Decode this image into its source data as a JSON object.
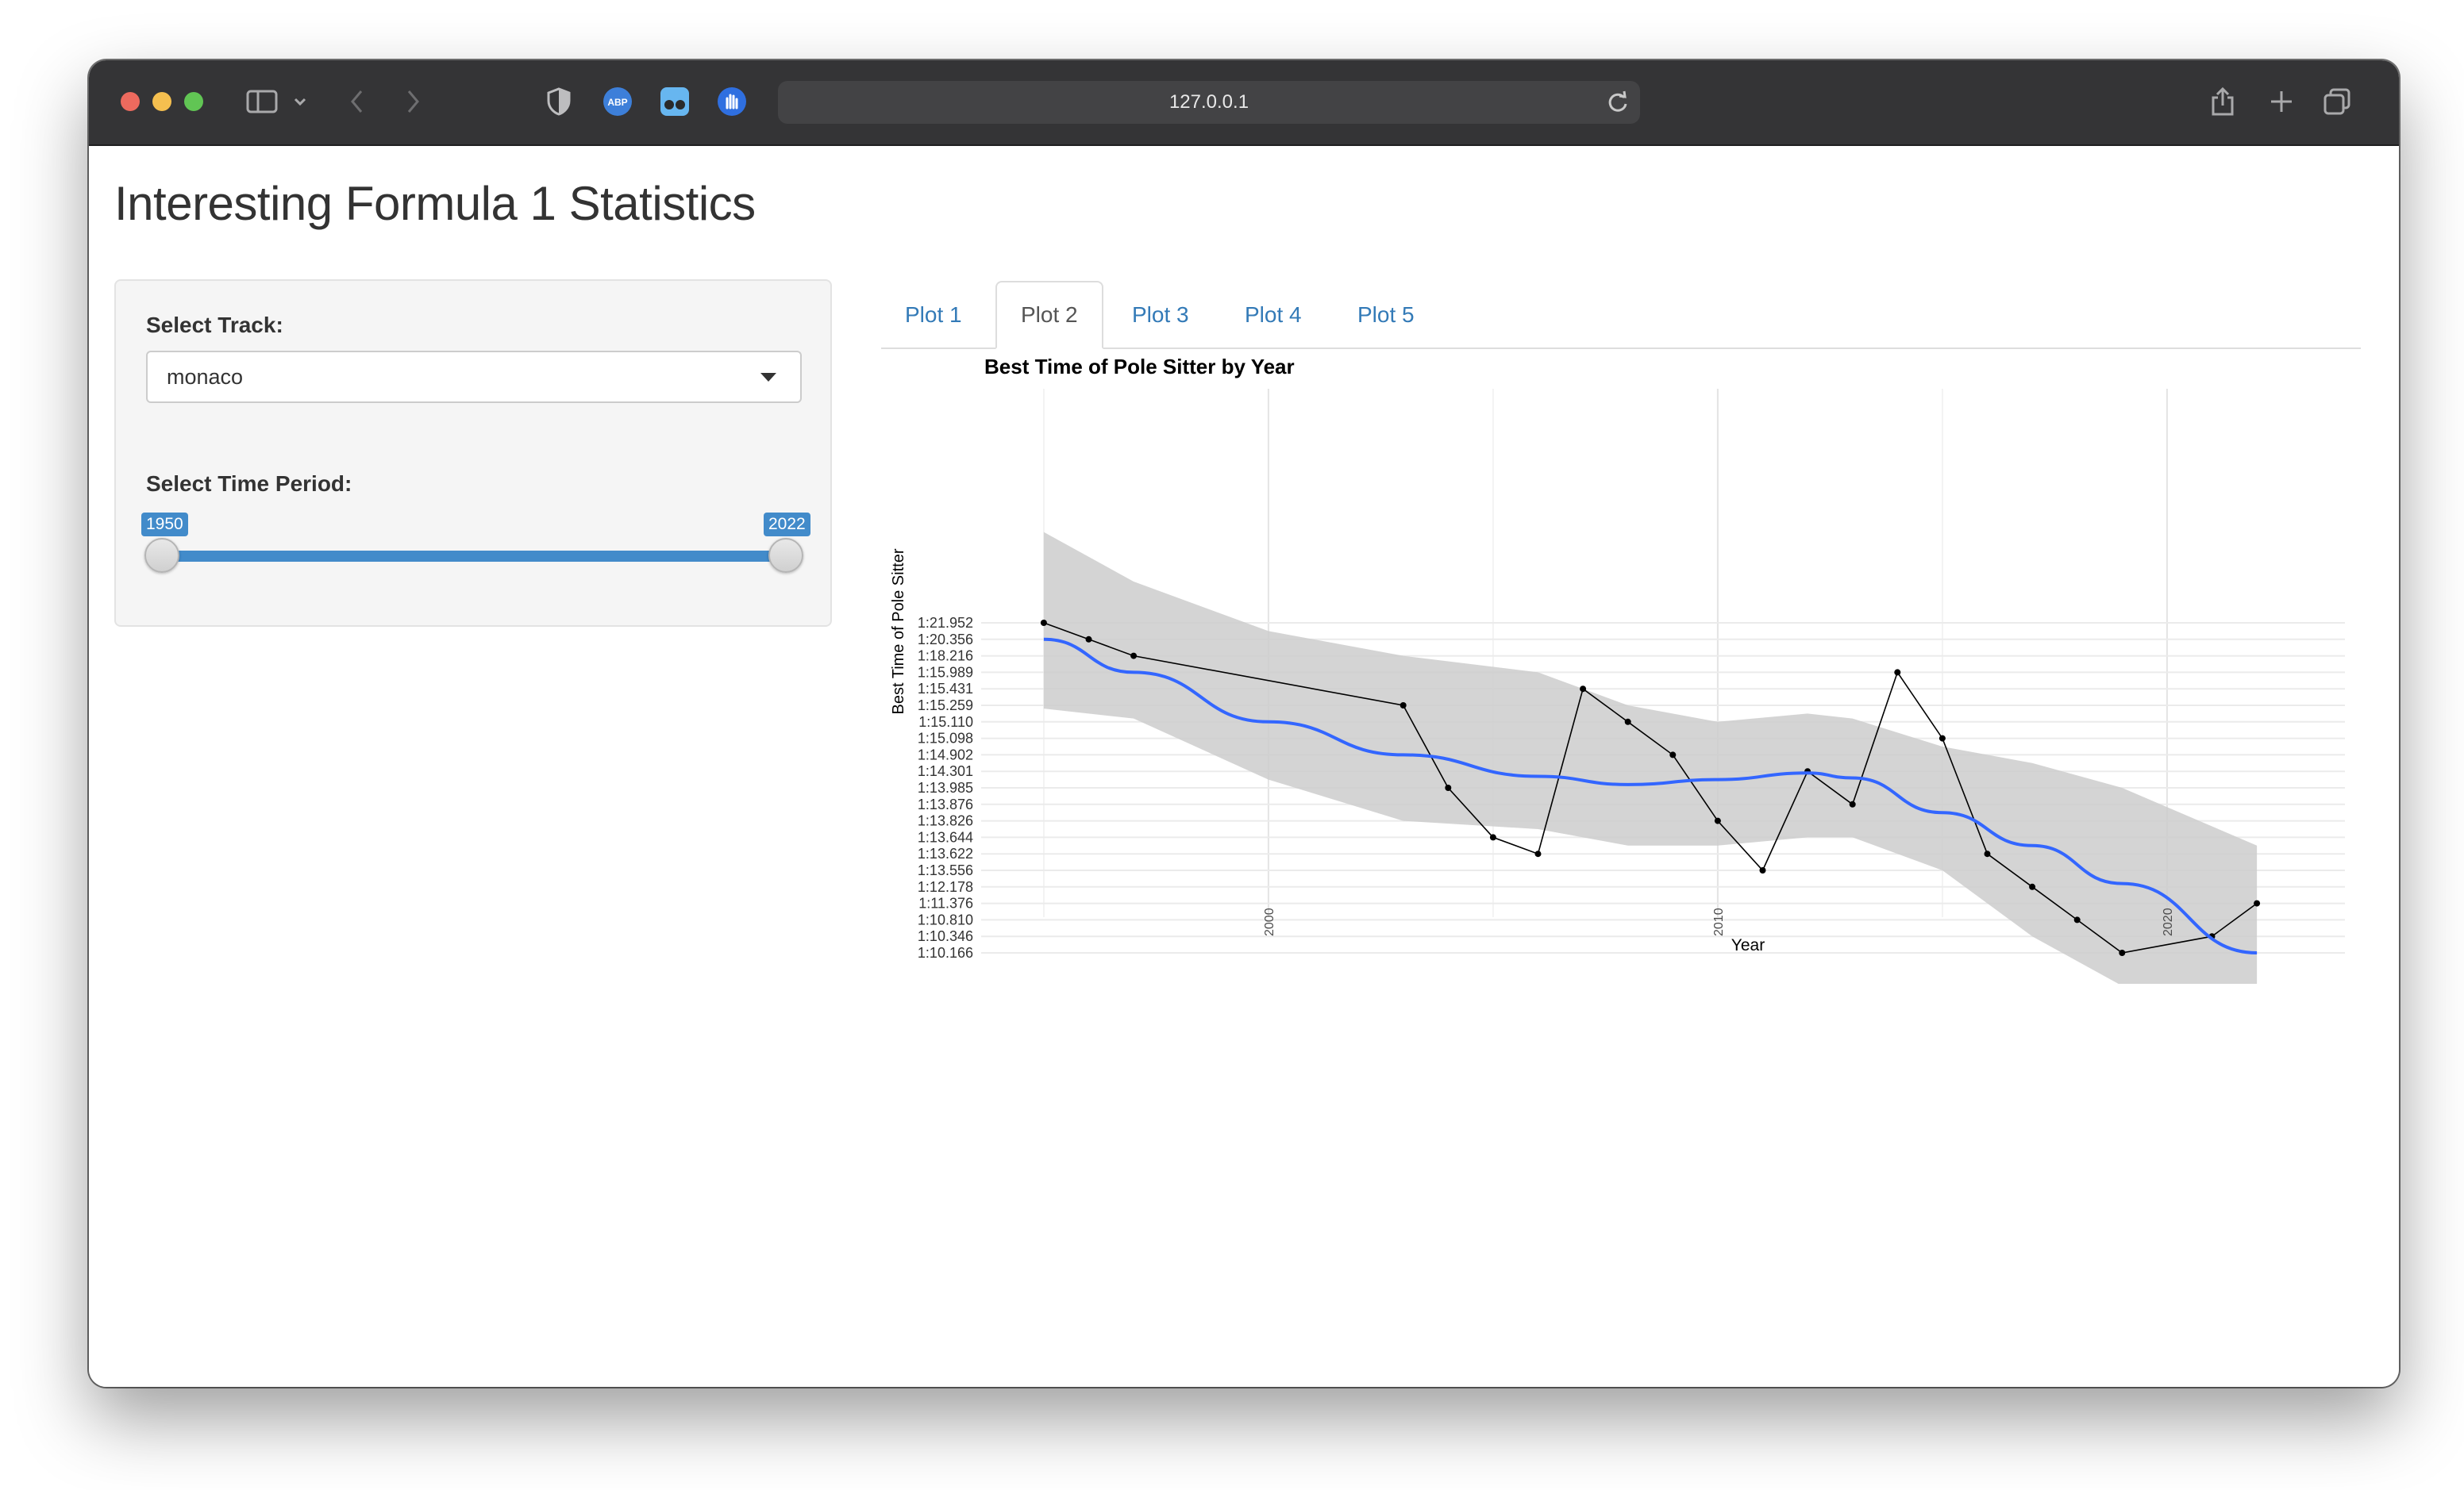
{
  "browser": {
    "url": "127.0.0.1"
  },
  "page": {
    "title": "Interesting Formula 1 Statistics"
  },
  "sidebar": {
    "track_label": "Select Track:",
    "track_value": "monaco",
    "period_label": "Select Time Period:",
    "period_min": "1950",
    "period_max": "2022",
    "range_fraction": [
      0,
      1
    ]
  },
  "tabs": [
    {
      "label": "Plot 1",
      "active": false
    },
    {
      "label": "Plot 2",
      "active": true
    },
    {
      "label": "Plot 3",
      "active": false
    },
    {
      "label": "Plot 4",
      "active": false
    },
    {
      "label": "Plot 5",
      "active": false
    }
  ],
  "chart_data": {
    "type": "line",
    "title": "Best Time of Pole Sitter by Year",
    "xlabel": "Year",
    "ylabel": "Best Time of Pole Sitter",
    "x_ticks": [
      "2000",
      "2010",
      "2020"
    ],
    "xlim": [
      1993.5,
      2023.5
    ],
    "y_categories": [
      "1:21.952",
      "1:20.356",
      "1:18.216",
      "1:15.989",
      "1:15.431",
      "1:15.259",
      "1:15.110",
      "1:15.098",
      "1:14.902",
      "1:14.301",
      "1:13.985",
      "1:13.876",
      "1:13.826",
      "1:13.644",
      "1:13.622",
      "1:13.556",
      "1:12.178",
      "1:11.376",
      "1:10.810",
      "1:10.346",
      "1:10.166"
    ],
    "points": [
      {
        "x": 1995,
        "y": "1:21.952"
      },
      {
        "x": 1996,
        "y": "1:20.356"
      },
      {
        "x": 1997,
        "y": "1:18.216"
      },
      {
        "x": 2003,
        "y": "1:15.259"
      },
      {
        "x": 2004,
        "y": "1:13.985"
      },
      {
        "x": 2005,
        "y": "1:13.644"
      },
      {
        "x": 2006,
        "y": "1:13.622"
      },
      {
        "x": 2007,
        "y": "1:15.431"
      },
      {
        "x": 2008,
        "y": "1:15.110"
      },
      {
        "x": 2009,
        "y": "1:14.902"
      },
      {
        "x": 2010,
        "y": "1:13.826"
      },
      {
        "x": 2011,
        "y": "1:13.556"
      },
      {
        "x": 2012,
        "y": "1:14.301"
      },
      {
        "x": 2013,
        "y": "1:13.876"
      },
      {
        "x": 2014,
        "y": "1:15.989"
      },
      {
        "x": 2015,
        "y": "1:15.098"
      },
      {
        "x": 2016,
        "y": "1:13.622"
      },
      {
        "x": 2017,
        "y": "1:12.178"
      },
      {
        "x": 2018,
        "y": "1:10.810"
      },
      {
        "x": 2019,
        "y": "1:10.166"
      },
      {
        "x": 2021,
        "y": "1:10.346"
      },
      {
        "x": 2022,
        "y": "1:11.376"
      }
    ],
    "smooth": {
      "color": "#3366ff",
      "x": [
        1995,
        1997,
        2000,
        2003,
        2006,
        2008,
        2010,
        2012,
        2013,
        2015,
        2017,
        2019,
        2022
      ],
      "y": [
        1.0,
        3.0,
        6.0,
        8.0,
        9.3,
        9.8,
        9.5,
        9.1,
        9.4,
        11.5,
        13.5,
        15.8,
        20.0
      ],
      "lo": [
        -5.5,
        -2.5,
        0.5,
        2.0,
        3.0,
        5.0,
        6.0,
        5.5,
        5.8,
        7.5,
        8.5,
        10.0,
        13.5
      ],
      "hi": [
        5.2,
        5.8,
        9.5,
        12.0,
        12.5,
        13.5,
        13.5,
        13.0,
        13.0,
        15.0,
        19.0,
        22.0,
        26.5
      ]
    },
    "band_color": "#cccccc",
    "grid": true,
    "background": "#ffffff"
  }
}
